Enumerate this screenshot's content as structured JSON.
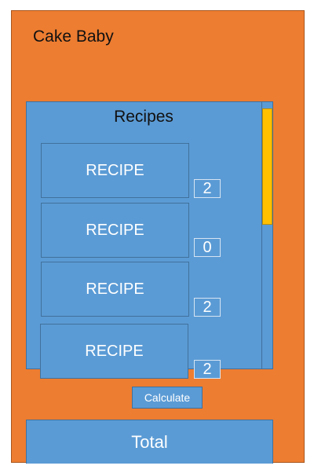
{
  "app": {
    "title": "Cake Baby"
  },
  "recipes": {
    "title": "Recipes",
    "items": [
      {
        "label": "RECIPE",
        "count": "2"
      },
      {
        "label": "RECIPE",
        "count": "0"
      },
      {
        "label": "RECIPE",
        "count": "2"
      },
      {
        "label": "RECIPE",
        "count": "2"
      }
    ]
  },
  "actions": {
    "calculate_label": "Calculate"
  },
  "total": {
    "label": "Total"
  },
  "colors": {
    "background": "#ed7d31",
    "panel": "#5b9bd5",
    "scroll_thumb": "#ffc000"
  }
}
